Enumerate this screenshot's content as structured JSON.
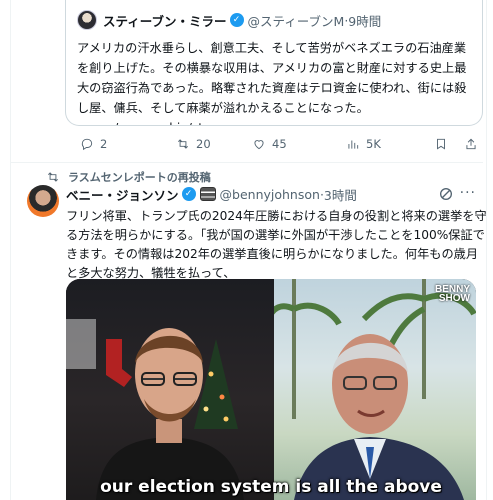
{
  "quoted_tweet": {
    "author_name": "スティーブン・ミラー",
    "author_handle": "@スティーブンM",
    "time": "9時間",
    "text_lines": [
      "アメリカの汗水垂らし、創意工夫、そして苦労がベネズエラの石油産業",
      "を創り上げた。その横暴な収用は、アメリカの富と財産に対する史上最",
      "大の窃盗行為であった。略奪された資産はテロ資金に使われ、街には殺",
      "し屋、傭兵、そして麻薬が溢れかえることになった。",
      "x.com/marcorubio/sta..."
    ]
  },
  "actions": {
    "reply_count": "2",
    "retweet_count": "20",
    "like_count": "45",
    "view_count": "5K"
  },
  "retweet_banner": "ラスムセンレポートの再投稿",
  "tweet": {
    "author_name": "ベニー・ジョンソン",
    "author_handle": "@bennyjohnson",
    "time": "3時間",
    "text_lines": [
      "フリン将軍、トランプ氏の2024年圧勝における自身の役割と将来の選挙を守",
      "る方法を明らかにする。「我が国の選挙に外国が干渉したことを100%保証で",
      "きます。その情報は202年の選挙直後に明らかになりました。何年もの歳月",
      "と多大な努力、犠牲を払って、"
    ]
  },
  "video": {
    "caption": "our election system is all the above",
    "logo_line1": "BENNY",
    "logo_line2": "SHOW"
  },
  "colors": {
    "accent": "#1d9bf0",
    "muted": "#536471",
    "border": "#cfd9de"
  }
}
